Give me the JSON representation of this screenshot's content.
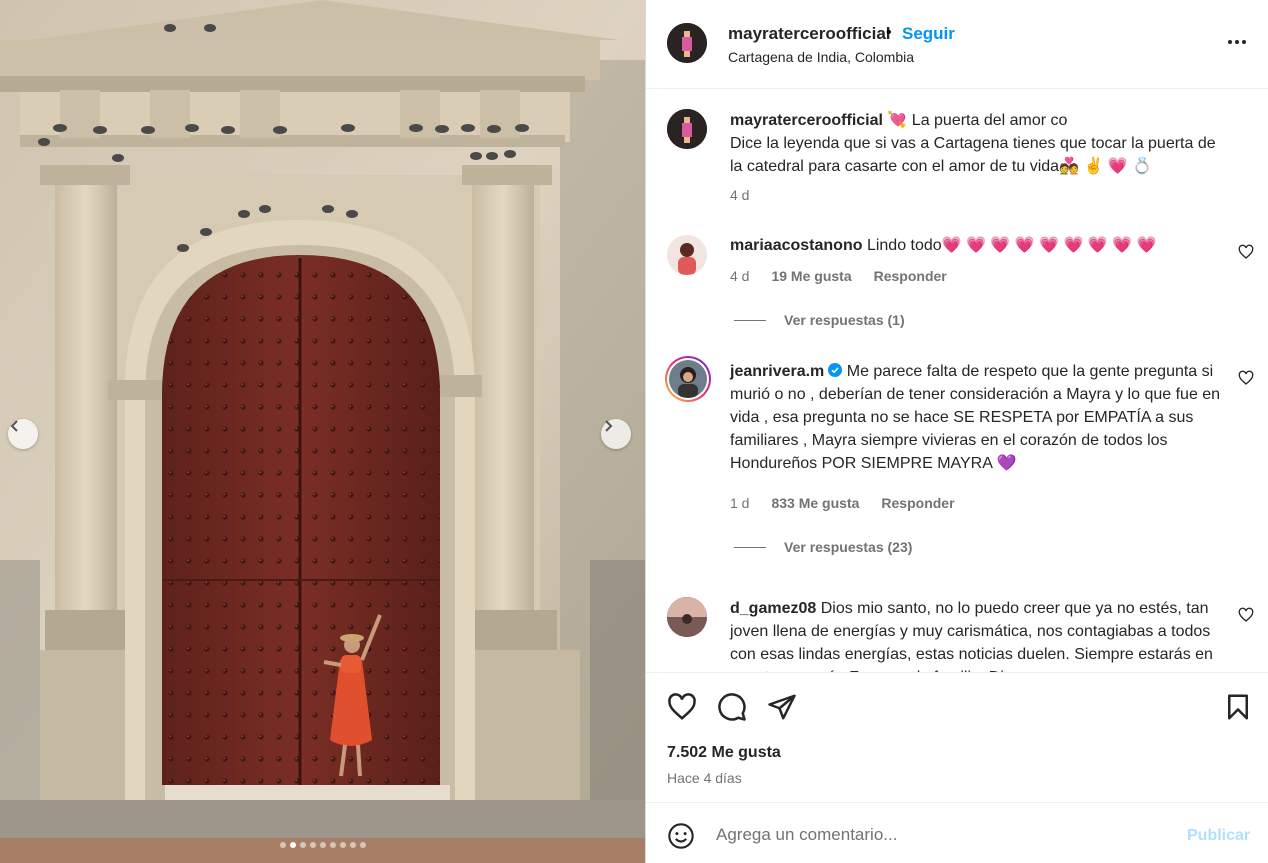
{
  "post": {
    "author": "mayraterceroofficial",
    "separator": "•",
    "follow_label": "Seguir",
    "location": "Cartagena de India, Colombia",
    "more_icon": "more-horizontal-icon",
    "carousel": {
      "prev_icon": "chevron-left-icon",
      "next_icon": "chevron-right-icon",
      "slides": 9,
      "active": 1
    }
  },
  "caption": {
    "username": "mayraterceroofficial",
    "text_line1": "💘  La puerta del amor co",
    "text_rest": "Dice la leyenda que si vas a Cartagena tienes que tocar la puerta de la catedral para casarte con el amor de tu vida💑 ✌️ 💗  💍",
    "time": "4 d"
  },
  "comments": [
    {
      "username": "mariaacostanono",
      "verified": false,
      "text": "Lindo todo💗 💗 💗 💗 💗 💗 💗 💗 💗",
      "time": "4 d",
      "likes": "19 Me gusta",
      "reply_label": "Responder",
      "view_replies": "Ver respuestas (1)"
    },
    {
      "username": "jeanrivera.m",
      "verified": true,
      "text": "Me parece falta de respeto que la gente pregunta si murió o no , deberían de tener consideración a Mayra y lo que fue en vida , esa pregunta no se hace SE RESPETA por EMPATÍA a sus familiares , Mayra siempre vivieras en el corazón de todos los Hondureños POR SIEMPRE MAYRA 💜",
      "time": "1 d",
      "likes": "833 Me gusta",
      "reply_label": "Responder",
      "view_replies": "Ver respuestas (23)"
    },
    {
      "username": "d_gamez08",
      "verified": false,
      "text": "Dios mio santo, no lo puedo creer que ya no estés, tan joven llena de energías y muy carismática, nos contagiabas a todos con esas lindas energías, estas noticias duelen. Siempre estarás en nuestro corazón Fuerza a la familia. Dios"
    }
  ],
  "actions": {
    "like_icon": "heart-icon",
    "comment_icon": "comment-icon",
    "share_icon": "send-icon",
    "save_icon": "bookmark-icon",
    "likes": "7.502 Me gusta",
    "time_ago": "Hace 4 días"
  },
  "compose": {
    "emoji_icon": "emoji-icon",
    "placeholder": "Agrega un comentario...",
    "publish_label": "Publicar"
  },
  "colors": {
    "link_blue": "#0095f6",
    "publish_disabled": "#b2dffc",
    "secondary_text": "#737373",
    "door_red": "#6e2a22"
  }
}
